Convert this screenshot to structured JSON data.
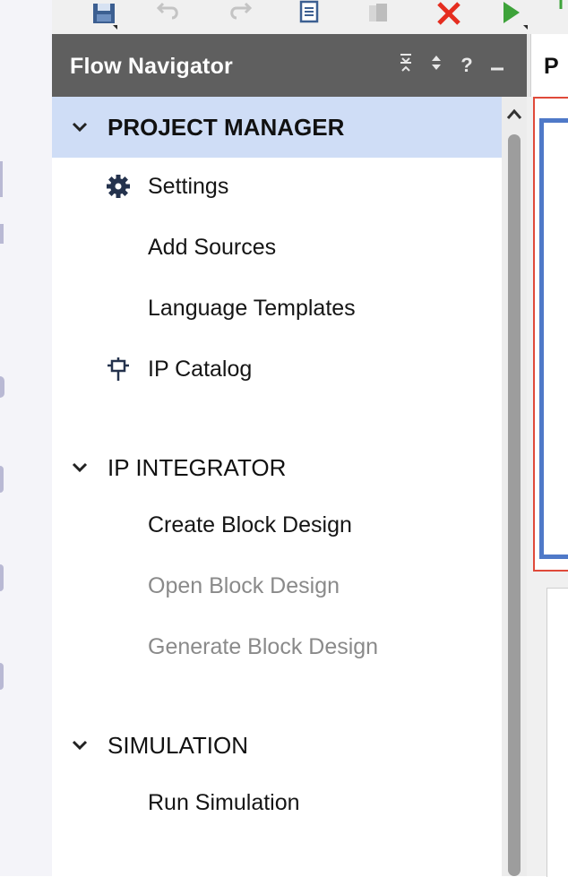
{
  "toolbar": {
    "icons": [
      "save-icon",
      "undo-icon",
      "redo-icon",
      "copy-icon",
      "paste-icon",
      "cancel-icon",
      "run-icon",
      "download-icon"
    ],
    "colors": {
      "cancel": "#e52d1f",
      "run": "#3ea33a",
      "icon_gray": "#8d8d8d",
      "icon_blue": "#3c5f91"
    }
  },
  "flow_navigator": {
    "title": "Flow Navigator",
    "tools": {
      "collapse": "≡",
      "expand": "↕",
      "help": "?",
      "minimize": "–"
    },
    "sections": [
      {
        "label": "PROJECT MANAGER",
        "active": true,
        "items": [
          {
            "label": "Settings",
            "icon": "gear-icon",
            "enabled": true
          },
          {
            "label": "Add Sources",
            "enabled": true
          },
          {
            "label": "Language Templates",
            "enabled": true
          },
          {
            "label": "IP Catalog",
            "icon": "ip-plug-icon",
            "enabled": true
          }
        ]
      },
      {
        "label": "IP INTEGRATOR",
        "active": false,
        "items": [
          {
            "label": "Create Block Design",
            "enabled": true
          },
          {
            "label": "Open Block Design",
            "enabled": false
          },
          {
            "label": "Generate Block Design",
            "enabled": false
          }
        ]
      },
      {
        "label": "SIMULATION",
        "active": false,
        "items": [
          {
            "label": "Run Simulation",
            "enabled": true
          }
        ]
      }
    ]
  },
  "right_panel": {
    "tab_label": "P"
  },
  "colors": {
    "header_bg": "#5f5f5f",
    "active_section_bg": "#cfddf6",
    "highlight_red": "#e04a3a",
    "highlight_blue": "#4f79c8"
  }
}
